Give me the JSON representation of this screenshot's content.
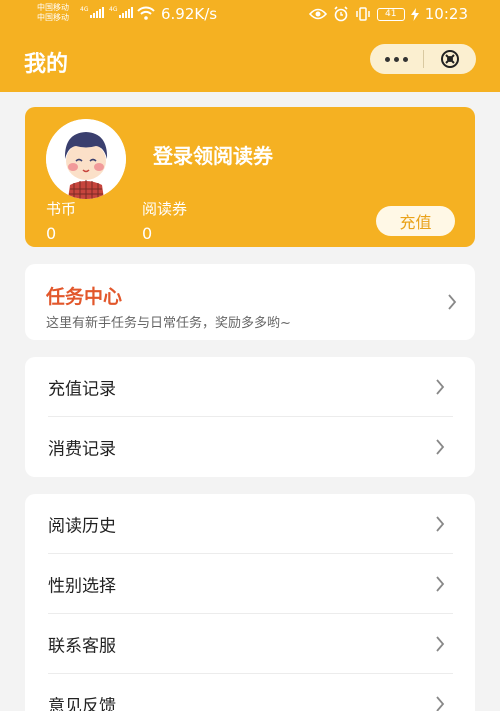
{
  "status_bar": {
    "carrier_1": "中国移动",
    "carrier_2": "中国移动",
    "network_1": "4G",
    "network_2": "4G",
    "net_speed": "6.92K/s",
    "battery": "41",
    "time": "10:23"
  },
  "header": {
    "title": "我的"
  },
  "profile": {
    "login_prompt": "登录领阅读券",
    "coins_label": "书币",
    "coins_value": "0",
    "vouchers_label": "阅读券",
    "vouchers_value": "0",
    "recharge_label": "充值"
  },
  "task_center": {
    "title": "任务中心",
    "subtitle": "这里有新手任务与日常任务，奖励多多哟~"
  },
  "records": [
    {
      "label": "充值记录"
    },
    {
      "label": "消费记录"
    }
  ],
  "settings": [
    {
      "label": "阅读历史"
    },
    {
      "label": "性别选择"
    },
    {
      "label": "联系客服"
    },
    {
      "label": "意见反馈"
    }
  ],
  "icons": {
    "more": "more-dots-icon",
    "close": "close-circle-icon",
    "chevron": "chevron-right-icon",
    "avatar": "avatar-boy-illustration"
  },
  "colors": {
    "brand": "#f5b122",
    "task_title": "#e2572b",
    "recharge_text": "#e9a21a"
  }
}
